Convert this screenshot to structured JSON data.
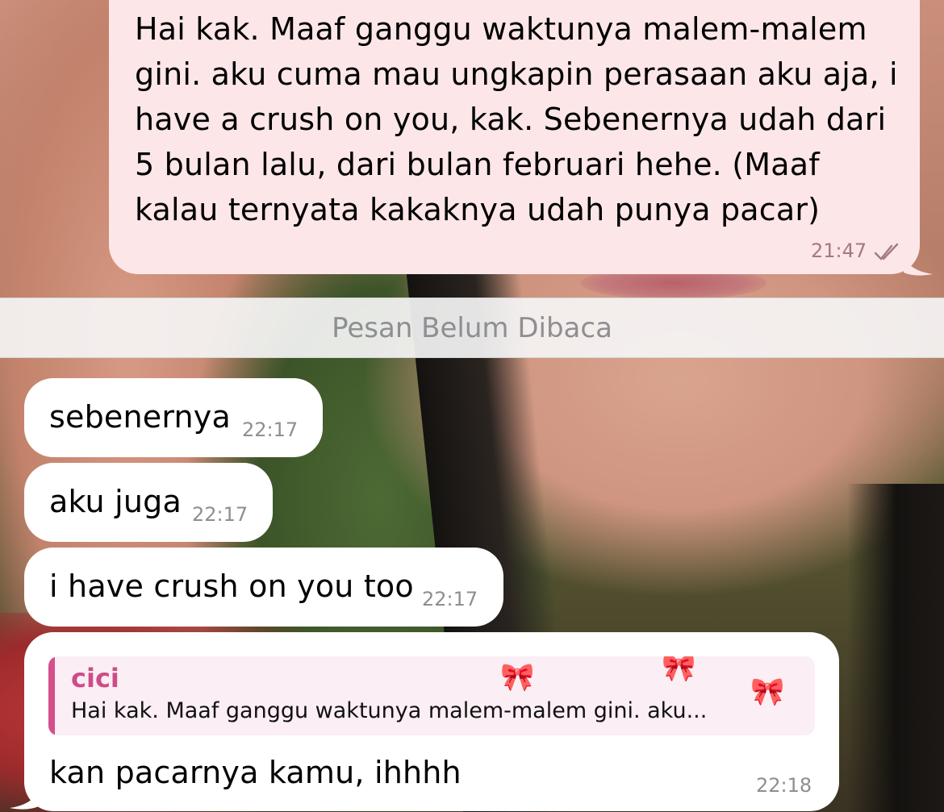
{
  "chat": {
    "outgoing": {
      "lines": [
        "Hai kak. Maaf ganggu waktunya malem-malem",
        "gini. aku cuma mau ungkapin perasaan aku aja, i",
        "have a crush on you, kak. Sebenernya udah dari",
        "5 bulan lalu, dari bulan februari hehe. (Maaf",
        "kalau ternyata kakaknya udah punya pacar)"
      ],
      "time": "21:47",
      "status_icon": "double-check-icon"
    },
    "unread_divider": "Pesan Belum Dibaca",
    "incoming": [
      {
        "text": "sebenernya",
        "time": "22:17"
      },
      {
        "text": "aku juga",
        "time": "22:17"
      },
      {
        "text": "i have crush on you too",
        "time": "22:17"
      }
    ],
    "reply_message": {
      "quoted_name": "cici",
      "quoted_text": "Hai kak. Maaf ganggu waktunya malem-malem gini. aku...",
      "text": "kan pacarnya kamu, ihhhh",
      "time": "22:18"
    }
  },
  "colors": {
    "outgoing_bubble": "#fce6e8",
    "incoming_bubble": "#ffffff",
    "reply_accent": "#d44f8c",
    "timestamp": "#8e8e93"
  }
}
